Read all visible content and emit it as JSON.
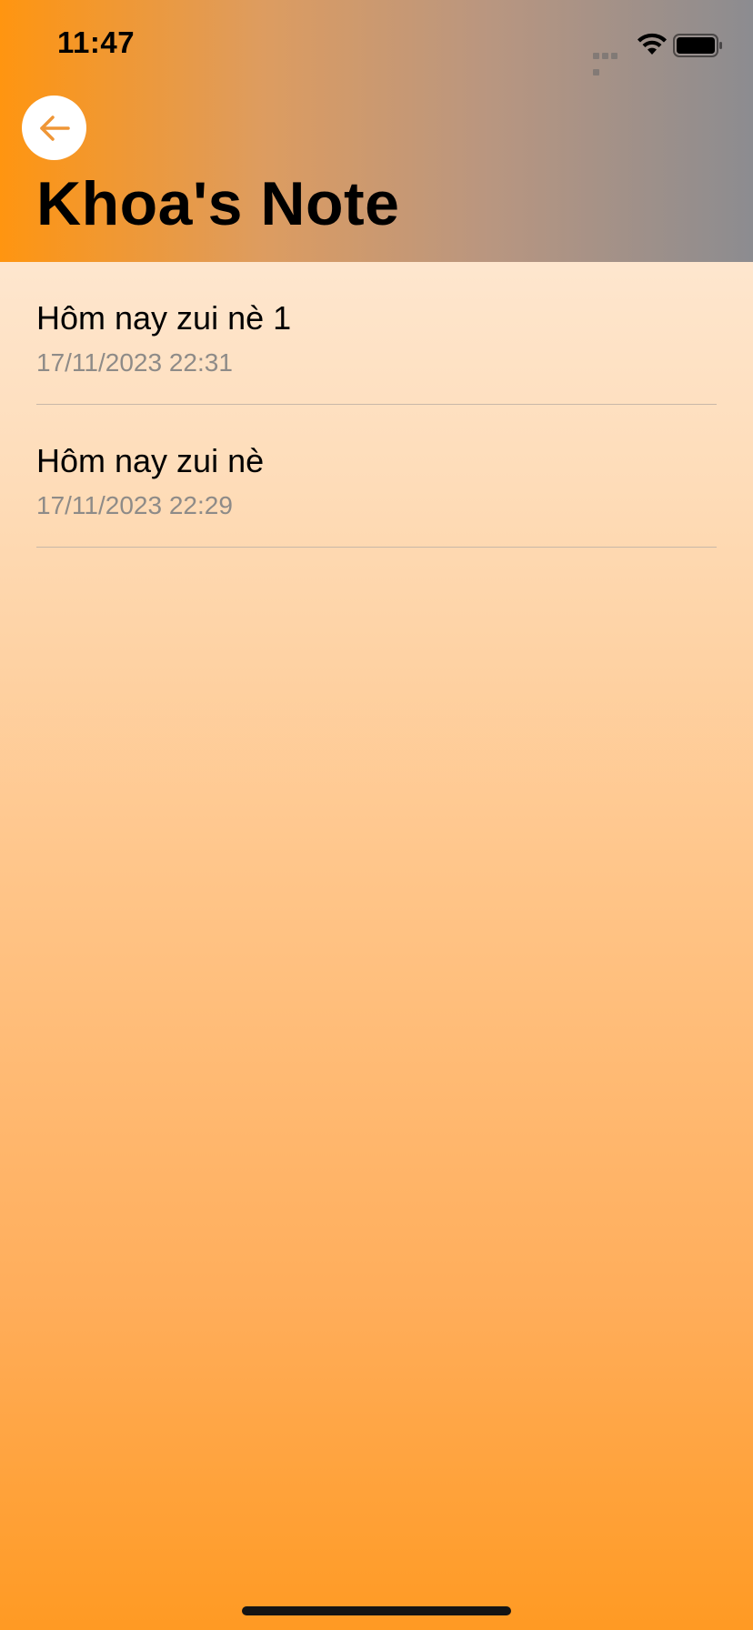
{
  "status_bar": {
    "time": "11:47"
  },
  "header": {
    "title": "Khoa's Note",
    "back_icon": "arrow-left-icon",
    "accent_color": "#ff9510"
  },
  "notes": [
    {
      "title": "Hôm nay zui nè 1",
      "date": "17/11/2023 22:31"
    },
    {
      "title": "Hôm nay zui nè",
      "date": "17/11/2023 22:29"
    }
  ]
}
